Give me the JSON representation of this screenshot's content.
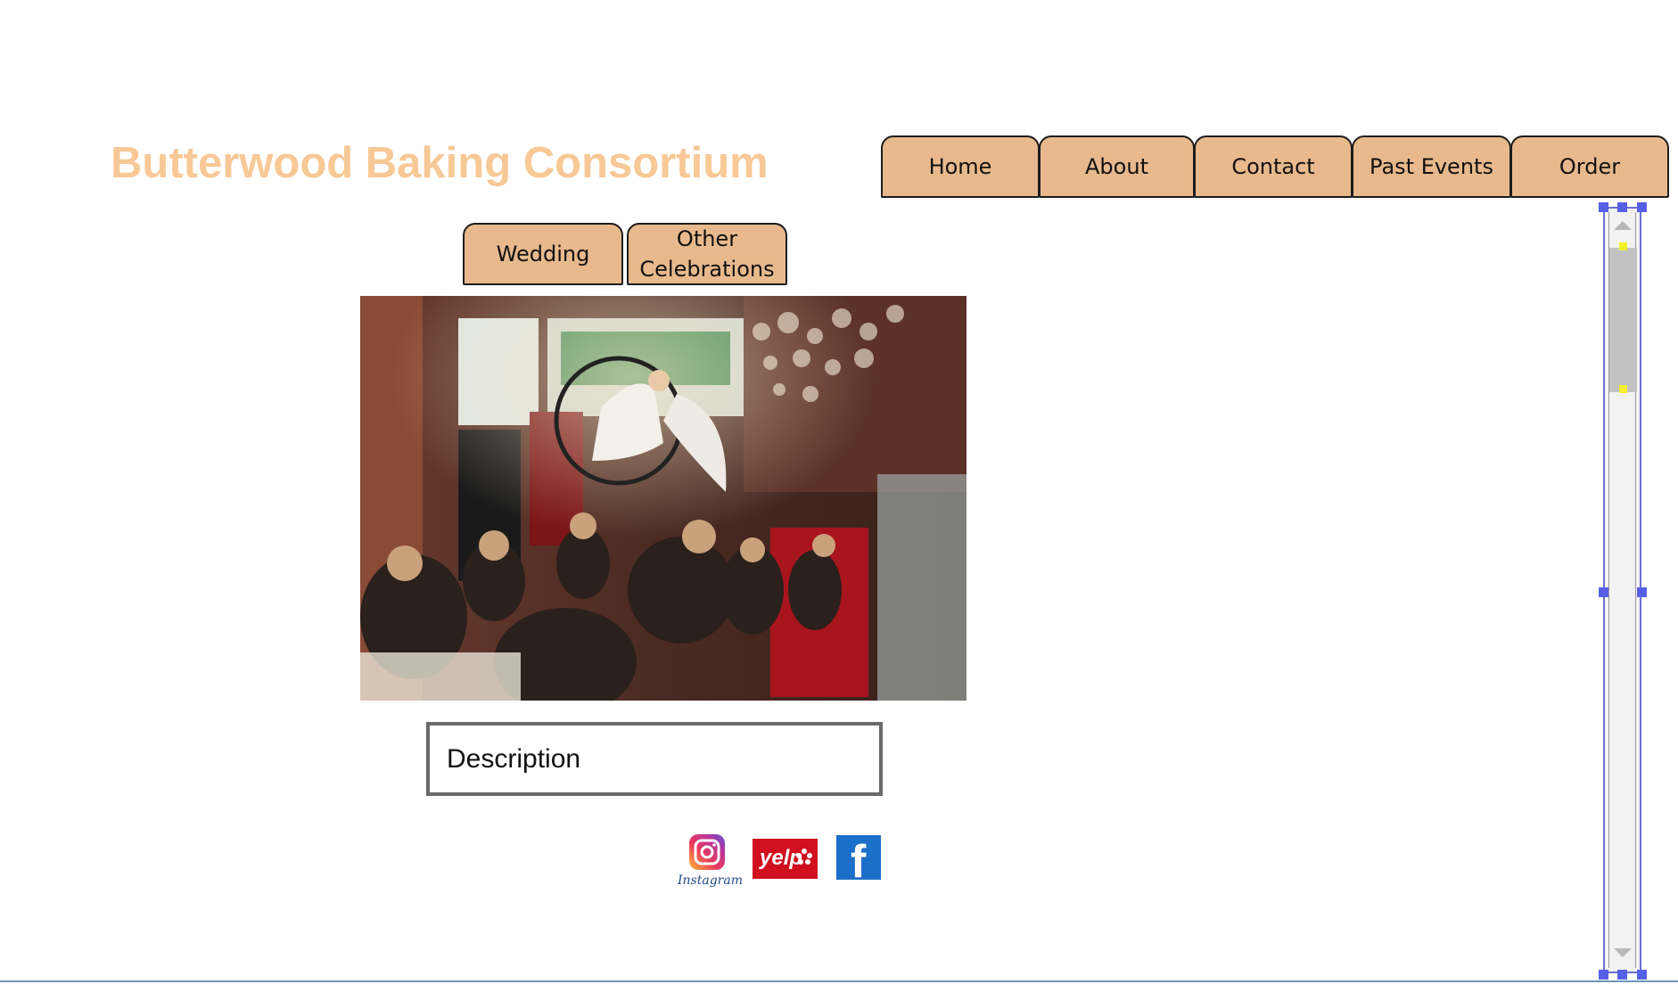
{
  "header": {
    "site_title": "Butterwood Baking Consortium"
  },
  "nav": {
    "items": [
      {
        "label": "Home"
      },
      {
        "label": "About"
      },
      {
        "label": "Contact"
      },
      {
        "label": "Past Events"
      },
      {
        "label": "Order"
      }
    ]
  },
  "subtabs": [
    {
      "label": "Wedding"
    },
    {
      "label": "Other Celebrations"
    }
  ],
  "content": {
    "description_placeholder": "Description"
  },
  "social": {
    "instagram_label": "Instagram",
    "yelp_label": "yelp",
    "facebook_label": "f"
  },
  "colors": {
    "title": "#f8c896",
    "tab_fill": "#e8b98c",
    "tab_border": "#1d1d1d",
    "selection_handle": "#5560e6"
  }
}
